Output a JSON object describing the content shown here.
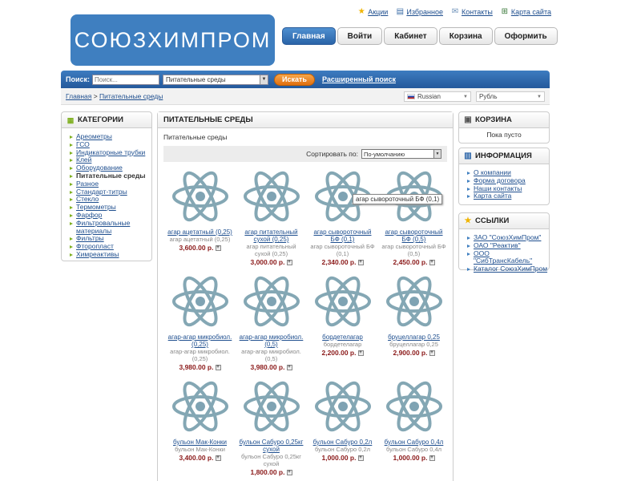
{
  "logo": {
    "text": "СОЮЗХИМПРОМ"
  },
  "toplinks": [
    {
      "label": "Акции",
      "icon": "star-icon"
    },
    {
      "label": "Избранное",
      "icon": "bookmark-icon"
    },
    {
      "label": "Контакты",
      "icon": "mail-icon"
    },
    {
      "label": "Карта сайта",
      "icon": "sitemap-icon"
    }
  ],
  "nav": [
    "Главная",
    "Войти",
    "Кабинет",
    "Корзина",
    "Оформить"
  ],
  "search": {
    "label": "Поиск:",
    "placeholder": "Поиск...",
    "category": "Питательные среды",
    "button": "Искать",
    "advanced": "Расширенный поиск"
  },
  "breadcrumb": {
    "home": "Главная",
    "sep": " > ",
    "current": "Питательные среды"
  },
  "language": "Russian",
  "currency": "Рубль",
  "categories": {
    "title": "КАТЕГОРИИ",
    "items": [
      "Ареометры",
      "ГСО",
      "Индикаторные трубки",
      "Клей",
      "Оборудование",
      "Питательные среды",
      "Разное",
      "Стандарт-титры",
      "Стекло",
      "Термометры",
      "Фарфор",
      "Фильтровальные материалы",
      "Фильтры",
      "Фторопласт",
      "Химреактивы"
    ],
    "current": 5
  },
  "main": {
    "title": "ПИТАТЕЛЬНЫЕ СРЕДЫ",
    "subtitle": "Питательные среды",
    "sort_label": "Сортировать по:",
    "sort_value": "По-умолчанию"
  },
  "products": [
    {
      "name": "агар ацетатный (0,25)",
      "desc": "агар ацетатный (0,25)",
      "price": "3,600.00 р."
    },
    {
      "name": "агар питательный сухой (0,25)",
      "desc": "агар питательный сухой (0,25)",
      "price": "3,000.00 р."
    },
    {
      "name": "агар сывороточный БФ (0,1)",
      "desc": "агар сывороточный БФ (0,1)",
      "price": "2,340.00 р."
    },
    {
      "name": "агар сывороточный БФ (0,5)",
      "desc": "агар сывороточный БФ (0,5)",
      "price": "2,450.00 р."
    },
    {
      "name": "агар-агар микробиол. (0,25)",
      "desc": "агар-агар микробиол. (0,25)",
      "price": "3,980.00 р."
    },
    {
      "name": "агар-агар микробиол. (0,5)",
      "desc": "агар-агар микробиол. (0,5)",
      "price": "3,980.00 р."
    },
    {
      "name": "бордетелагар",
      "desc": "бордетелагар",
      "price": "2,200.00 р."
    },
    {
      "name": "бруцеллагар 0,25",
      "desc": "бруцеллагар 0,25",
      "price": "2,900.00 р."
    },
    {
      "name": "бульон Мак-Конки",
      "desc": "бульон Мак-Конки",
      "price": "3,400.00 р."
    },
    {
      "name": "бульон Сабуро 0,25кг сухой",
      "desc": "бульон Сабуро 0,25кг сухой",
      "price": "1,800.00 р."
    },
    {
      "name": "бульон Сабуро 0,2л",
      "desc": "бульон Сабуро 0,2л",
      "price": "1,000.00 р."
    },
    {
      "name": "бульон Сабуро 0,4л",
      "desc": "бульон Сабуро 0,4л",
      "price": "1,000.00 р."
    }
  ],
  "tooltip": "агар сывороточный БФ (0,1)",
  "cart": {
    "title": "КОРЗИНА",
    "empty": "Пока пусто"
  },
  "info": {
    "title": "ИНФОРМАЦИЯ",
    "items": [
      "О компании",
      "Форма договора",
      "Наши контакты",
      "Карта сайта"
    ]
  },
  "links": {
    "title": "ССЫЛКИ",
    "items": [
      "ЗАО \"СоюзХимПром\"",
      "ОАО \"Реактив\"",
      "ООО \"СибТрансКабель\"",
      "Каталог СоюзХимПром"
    ]
  },
  "colors": {
    "brand_blue": "#3f7fc0",
    "search_button": "#f08a20",
    "price": "#8b1a1a",
    "bullet_green": "#7fb020"
  }
}
